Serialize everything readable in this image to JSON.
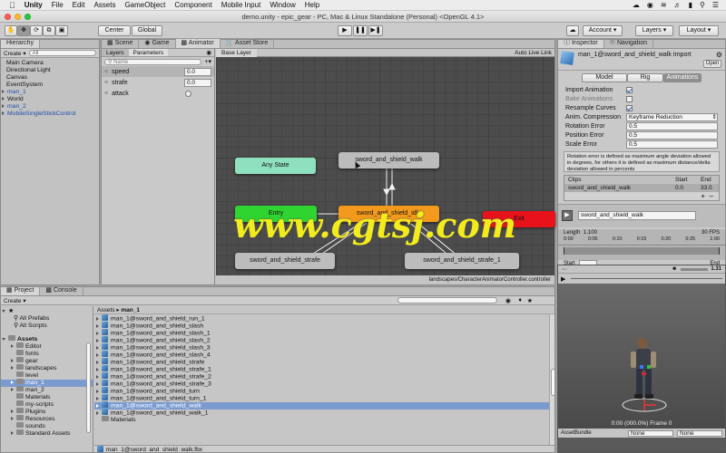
{
  "menubar": {
    "apple": "",
    "app": "Unity",
    "items": [
      "File",
      "Edit",
      "Assets",
      "GameObject",
      "Component",
      "Mobile Input",
      "Window",
      "Help"
    ]
  },
  "window": {
    "title": "demo.unity - epic_gear - PC, Mac & Linux Standalone (Personal) <OpenGL 4.1>"
  },
  "toolbar": {
    "center": "Center",
    "global": "Global",
    "account": "Account",
    "layers": "Layers",
    "layout": "Layout"
  },
  "hierarchy": {
    "tab": "Hierarchy",
    "create": "Create",
    "search_placeholder": "All",
    "items": [
      "Main Camera",
      "Directional Light",
      "Canvas",
      "EventSystem",
      "man_1",
      "World",
      "man_2",
      "MobileSingleStickControl"
    ]
  },
  "center_tabs": [
    "Scene",
    "Game",
    "Animator",
    "Asset Store"
  ],
  "animator": {
    "layers_tab": "Layers",
    "params_tab": "Parameters",
    "search_placeholder": "Name",
    "base_layer": "Base Layer",
    "auto_live": "Auto Live Link",
    "params": [
      {
        "name": "speed",
        "value": "0.0"
      },
      {
        "name": "strafe",
        "value": "0.0"
      },
      {
        "name": "attack",
        "value": ""
      }
    ],
    "states": {
      "any": "Any State",
      "entry": "Entry",
      "exit": "Exit",
      "walk": "sword_and_shield_walk",
      "idle": "sword_and_shield_idle",
      "strafe": "sword_and_shield_strafe",
      "strafe1": "sword_and_shield_strafe_1"
    },
    "path": "landscapes/CharacterAnimatorController.controller"
  },
  "watermark": "www.cgtsj.com",
  "inspector": {
    "tab": "Inspector",
    "nav_tab": "Navigation",
    "title": "man_1@sword_and_shield_walk Import",
    "open": "Open",
    "subtabs": [
      "Model",
      "Rig",
      "Animations"
    ],
    "import_animation": "Import Animation",
    "bake_animations": "Bake Animations",
    "resample": "Resample Curves",
    "compression_label": "Anim. Compression",
    "compression_value": "Keyframe Reduction",
    "rot_label": "Rotation Error",
    "rot_value": "0.5",
    "pos_label": "Position Error",
    "pos_value": "0.5",
    "scale_label": "Scale Error",
    "scale_value": "0.5",
    "help": "Rotation error is defined as maximum angle deviation allowed in degrees, for others it is defined as maximum distance/delta deviation allowed in percents",
    "clips_header": "Clips",
    "start_header": "Start",
    "end_header": "End",
    "clip_name": "sword_and_shield_walk",
    "clip_start": "0.0",
    "clip_end": "33.0",
    "clip_field": "sword_and_shield_walk",
    "length_label": "Length",
    "length_value": "1.100",
    "fps": "30 FPS",
    "ticks": [
      "0:00",
      "0:05",
      "0:10",
      "0:15",
      "0:20",
      "0:25",
      "1:00"
    ],
    "start_label": "Start",
    "end_label": "End",
    "speed": "1.31"
  },
  "preview": {
    "time": "0:00 (000.0%) Frame 0",
    "bundle": "AssetBundle",
    "none1": "None",
    "none2": "None"
  },
  "project": {
    "tab": "Project",
    "console_tab": "Console",
    "create": "Create",
    "favorites": [
      "All Prefabs",
      "All Scripts"
    ],
    "assets_root": "Assets",
    "folders": [
      "Editor",
      "fonts",
      "gear",
      "landscapes",
      "level",
      "man_1",
      "man_2",
      "Materials",
      "my-scripts",
      "Plugins",
      "Resources",
      "sounds",
      "Standard Assets"
    ],
    "breadcrumb_root": "Assets",
    "breadcrumb_child": "man_1",
    "files": [
      "man_1@sword_and_shield_run_1",
      "man_1@sword_and_shield_slash",
      "man_1@sword_and_shield_slash_1",
      "man_1@sword_and_shield_slash_2",
      "man_1@sword_and_shield_slash_3",
      "man_1@sword_and_shield_slash_4",
      "man_1@sword_and_shield_strafe",
      "man_1@sword_and_shield_strafe_1",
      "man_1@sword_and_shield_strafe_2",
      "man_1@sword_and_shield_strafe_3",
      "man_1@sword_and_shield_turn",
      "man_1@sword_and_shield_turn_1",
      "man_1@sword_and_shield_walk",
      "man_1@sword_and_shield_walk_1",
      "Materials"
    ],
    "selected_file": "man_1@sword_and_shield_walk.fbx"
  },
  "colors": {
    "any": "#8fe0bf",
    "entry": "#2fd431",
    "idle": "#f39a1c",
    "exit": "#e8121a",
    "state": "#bcbcbc",
    "watermark": "#f2ec1c"
  }
}
